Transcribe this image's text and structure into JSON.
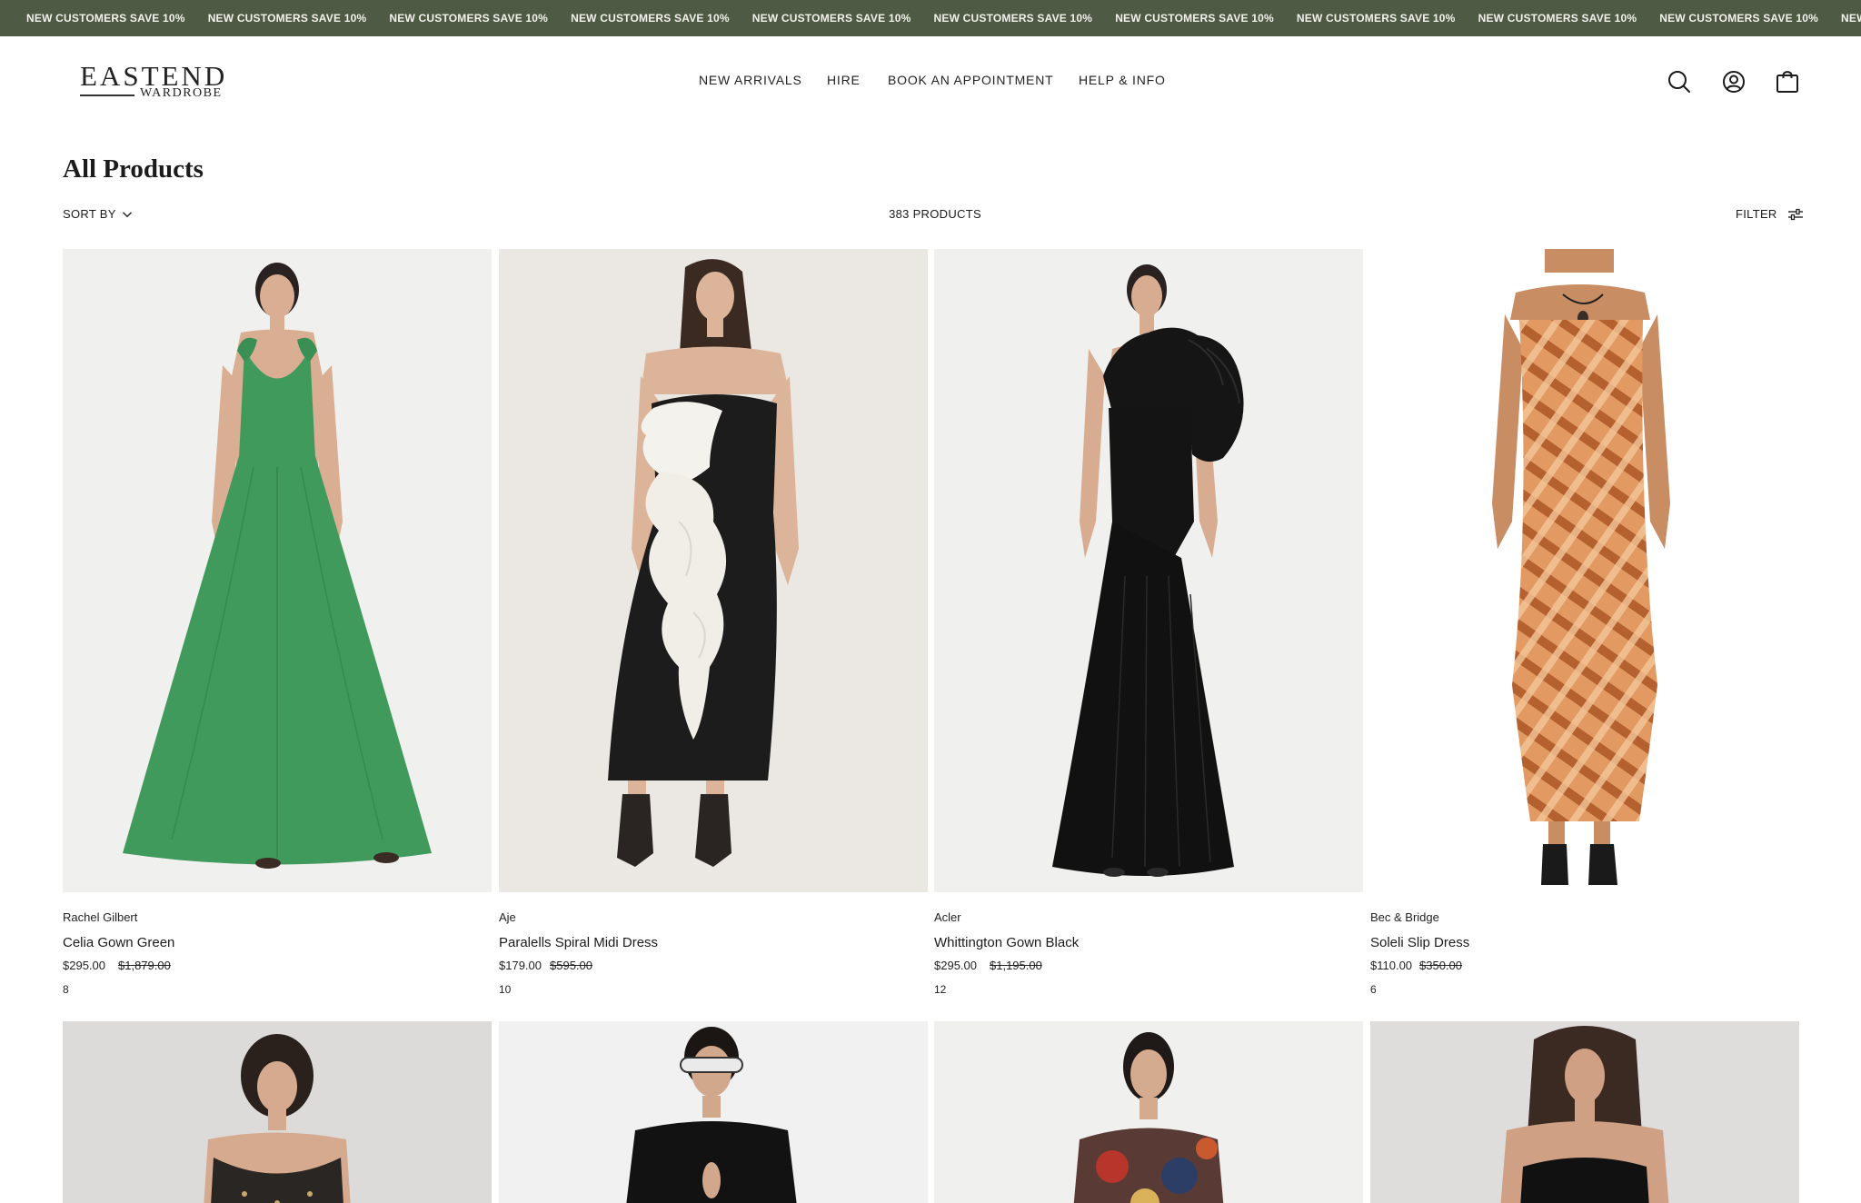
{
  "announcement": {
    "text": "NEW CUSTOMERS SAVE 10%",
    "repeats": 11,
    "colors": {
      "background": "#4f5a44",
      "text": "#f2f2ec"
    }
  },
  "header": {
    "logo": {
      "main": "EASTEND",
      "sub": "WARDROBE"
    },
    "nav": [
      "NEW ARRIVALS",
      "HIRE",
      "BOOK AN APPOINTMENT",
      "HELP & INFO"
    ],
    "icons": [
      "search-icon",
      "account-icon",
      "bag-icon"
    ]
  },
  "collection": {
    "title": "All Products",
    "sort_label": "SORT BY",
    "count_label": "383 PRODUCTS",
    "filter_label": "FILTER"
  },
  "products": [
    {
      "brand": "Rachel Gilbert",
      "name": "Celia Gown Green",
      "price": "$295.00",
      "compare_price": "$1,879.00",
      "size": "8",
      "image_color": "#3f9a5c"
    },
    {
      "brand": "Aje",
      "name": "Paralells Spiral Midi Dress",
      "price": "$179.00",
      "compare_price": "$595.00",
      "size": "10",
      "image_color": "#1c1c1c"
    },
    {
      "brand": "Acler",
      "name": "Whittington Gown Black",
      "price": "$295.00",
      "compare_price": "$1,195.00",
      "size": "12",
      "image_color": "#141414"
    },
    {
      "brand": "Bec & Bridge",
      "name": "Soleli Slip Dress",
      "price": "$110.00",
      "compare_price": "$350.00",
      "size": "6",
      "image_color": "#d9925a"
    }
  ],
  "second_row": [
    {
      "image_color": "#2a2624"
    },
    {
      "image_color": "#121212"
    },
    {
      "image_color": "#5a3a34"
    },
    {
      "image_color": "#111111"
    }
  ]
}
